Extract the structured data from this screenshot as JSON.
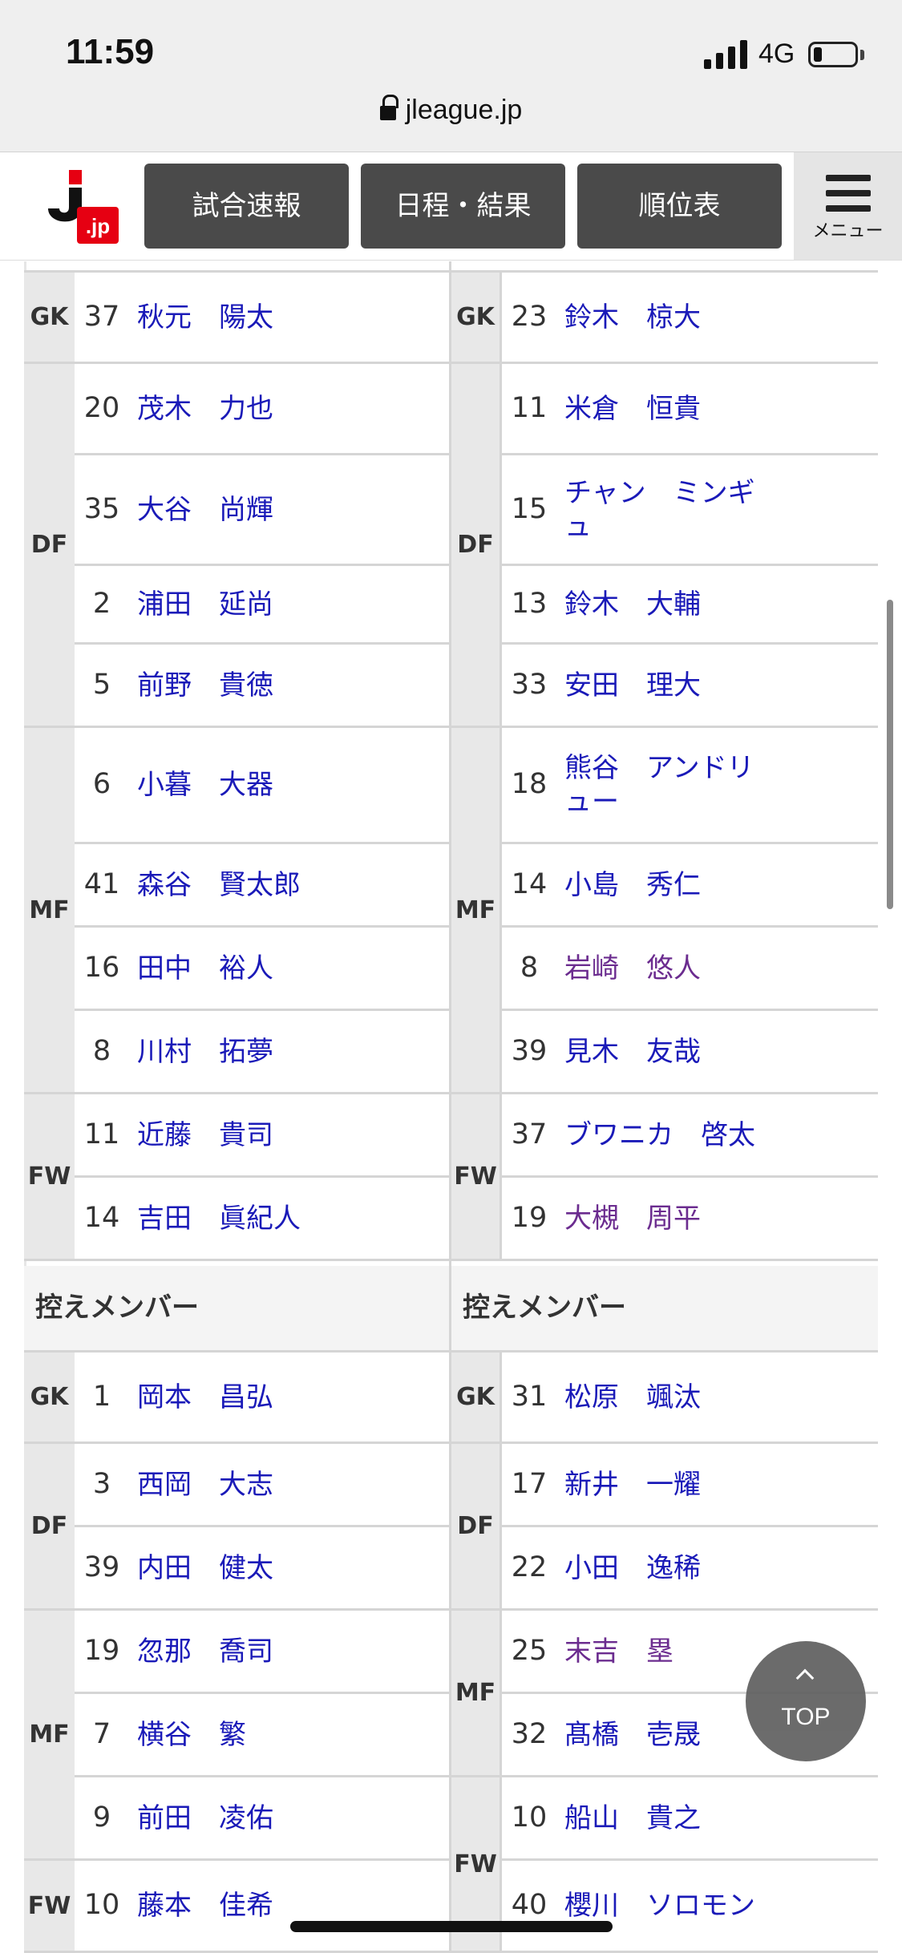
{
  "status_bar": {
    "time": "11:59",
    "network": "4G",
    "battery_level": 0.2
  },
  "url_bar": {
    "domain": "jleague.jp",
    "lock_icon": "lock-icon"
  },
  "site_header": {
    "logo_text": "J.jp",
    "nav": [
      "試合速報",
      "日程・結果",
      "順位表"
    ],
    "menu_label": "メニュー",
    "menu_icon": "hamburger-icon"
  },
  "home_starters": {
    "groups": [
      {
        "pos": "GK",
        "players": [
          {
            "num": "37",
            "name": "秋元　陽太"
          }
        ]
      },
      {
        "pos": "DF",
        "players": [
          {
            "num": "20",
            "name": "茂木　力也"
          },
          {
            "num": "35",
            "name": "大谷　尚輝"
          },
          {
            "num": "2",
            "name": "浦田　延尚"
          },
          {
            "num": "5",
            "name": "前野　貴徳"
          }
        ]
      },
      {
        "pos": "MF",
        "players": [
          {
            "num": "6",
            "name": "小暮　大器"
          },
          {
            "num": "41",
            "name": "森谷　賢太郎"
          },
          {
            "num": "16",
            "name": "田中　裕人"
          },
          {
            "num": "8",
            "name": "川村　拓夢"
          }
        ]
      },
      {
        "pos": "FW",
        "players": [
          {
            "num": "11",
            "name": "近藤　貴司"
          },
          {
            "num": "14",
            "name": "吉田　眞紀人"
          }
        ]
      }
    ]
  },
  "away_starters": {
    "groups": [
      {
        "pos": "GK",
        "players": [
          {
            "num": "23",
            "name": "鈴木　椋大"
          }
        ]
      },
      {
        "pos": "DF",
        "players": [
          {
            "num": "11",
            "name": "米倉　恒貴"
          },
          {
            "num": "15",
            "name": "チャン　ミンギュ"
          },
          {
            "num": "13",
            "name": "鈴木　大輔"
          },
          {
            "num": "33",
            "name": "安田　理大"
          }
        ]
      },
      {
        "pos": "MF",
        "players": [
          {
            "num": "18",
            "name": "熊谷　アンドリュー"
          },
          {
            "num": "14",
            "name": "小島　秀仁"
          },
          {
            "num": "8",
            "name": "岩崎　悠人"
          },
          {
            "num": "39",
            "name": "見木　友哉"
          }
        ]
      },
      {
        "pos": "FW",
        "players": [
          {
            "num": "37",
            "name": "ブワニカ　啓太"
          },
          {
            "num": "19",
            "name": "大槻　周平"
          }
        ]
      }
    ]
  },
  "subs_header": {
    "home": "控えメンバー",
    "away": "控えメンバー"
  },
  "home_subs": {
    "groups": [
      {
        "pos": "GK",
        "players": [
          {
            "num": "1",
            "name": "岡本　昌弘"
          }
        ]
      },
      {
        "pos": "DF",
        "players": [
          {
            "num": "3",
            "name": "西岡　大志"
          },
          {
            "num": "39",
            "name": "内田　健太"
          }
        ]
      },
      {
        "pos": "MF",
        "players": [
          {
            "num": "19",
            "name": "忽那　喬司"
          },
          {
            "num": "7",
            "name": "横谷　繁"
          },
          {
            "num": "9",
            "name": "前田　凌佑"
          }
        ]
      },
      {
        "pos": "FW",
        "players": [
          {
            "num": "10",
            "name": "藤本　佳希"
          }
        ]
      }
    ]
  },
  "away_subs": {
    "groups": [
      {
        "pos": "GK",
        "players": [
          {
            "num": "31",
            "name": "松原　颯汰"
          }
        ]
      },
      {
        "pos": "DF",
        "players": [
          {
            "num": "17",
            "name": "新井　一耀"
          },
          {
            "num": "22",
            "name": "小田　逸稀"
          }
        ]
      },
      {
        "pos": "MF",
        "players": [
          {
            "num": "25",
            "name": "末吉　塁"
          },
          {
            "num": "32",
            "name": "髙橋　壱晟"
          }
        ]
      },
      {
        "pos": "FW",
        "players": [
          {
            "num": "10",
            "name": "船山　貴之"
          },
          {
            "num": "40",
            "name": "櫻川　ソロモン"
          }
        ]
      }
    ]
  },
  "top_button": {
    "label": "TOP",
    "icon": "chevron-up-icon"
  },
  "colors": {
    "link": "#1a1ab8",
    "visited": "#6b2c8f",
    "nav_bg": "#4a4a4a",
    "brand_red": "#e60012"
  }
}
